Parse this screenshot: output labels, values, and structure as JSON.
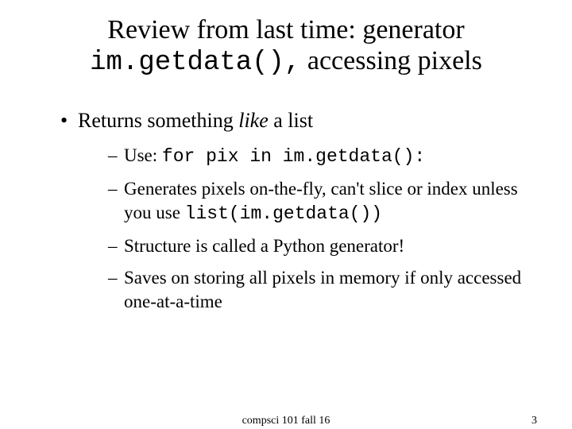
{
  "title": {
    "line1": "Review from last time: generator",
    "line2_code": "im.getdata(),",
    "line2_rest": " accessing pixels"
  },
  "bullet": {
    "dot": "•",
    "pre": "Returns something ",
    "italic": "like",
    "post": " a list"
  },
  "subs": {
    "dash": "–",
    "s1_pre": "Use: ",
    "s1_code": "for pix in im.getdata():",
    "s2_pre": "Generates pixels on-the-fly, can't slice or index unless you use ",
    "s2_code": "list(im.getdata())",
    "s3": "Structure is called a Python generator!",
    "s4": "Saves on storing all pixels in memory if only accessed one-at-a-time"
  },
  "footer": {
    "center": "compsci 101 fall 16",
    "page": "3"
  }
}
